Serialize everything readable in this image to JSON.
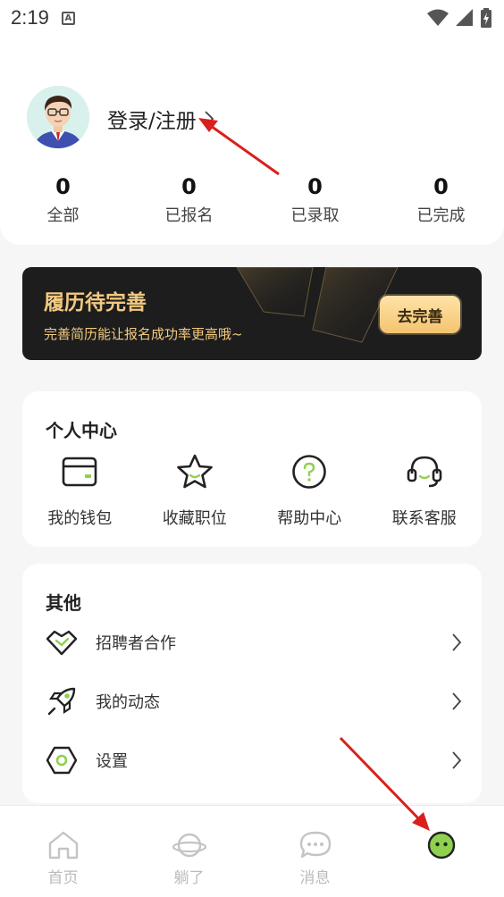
{
  "status_bar": {
    "time": "2:19",
    "notification_icon_letter": "A"
  },
  "profile": {
    "login_label": "登录/注册"
  },
  "stats": [
    {
      "value": "0",
      "label": "全部"
    },
    {
      "value": "0",
      "label": "已报名"
    },
    {
      "value": "0",
      "label": "已录取"
    },
    {
      "value": "0",
      "label": "已完成"
    }
  ],
  "resume_banner": {
    "title": "履历待完善",
    "subtitle": "完善简历能让报名成功率更高哦~",
    "button_label": "去完善"
  },
  "personal_center": {
    "title": "个人中心",
    "items": [
      {
        "label": "我的钱包",
        "icon": "wallet-icon"
      },
      {
        "label": "收藏职位",
        "icon": "star-icon"
      },
      {
        "label": "帮助中心",
        "icon": "help-icon"
      },
      {
        "label": "联系客服",
        "icon": "headset-icon"
      }
    ]
  },
  "other": {
    "title": "其他",
    "items": [
      {
        "label": "招聘者合作",
        "icon": "handshake-icon"
      },
      {
        "label": "我的动态",
        "icon": "rocket-icon"
      },
      {
        "label": "设置",
        "icon": "hexagon-settings-icon"
      }
    ]
  },
  "tab_bar": {
    "tabs": [
      {
        "label": "首页",
        "icon": "home-icon"
      },
      {
        "label": "躺了",
        "icon": "planet-icon"
      },
      {
        "label": "消息",
        "icon": "chat-icon"
      },
      {
        "label": "",
        "icon": "smiley-face-icon"
      }
    ]
  },
  "colors": {
    "accent_green": "#8fd14f",
    "banner_bg": "#1d1d1d",
    "banner_gold": "#f2c980",
    "annotation_red": "#d9201c"
  }
}
